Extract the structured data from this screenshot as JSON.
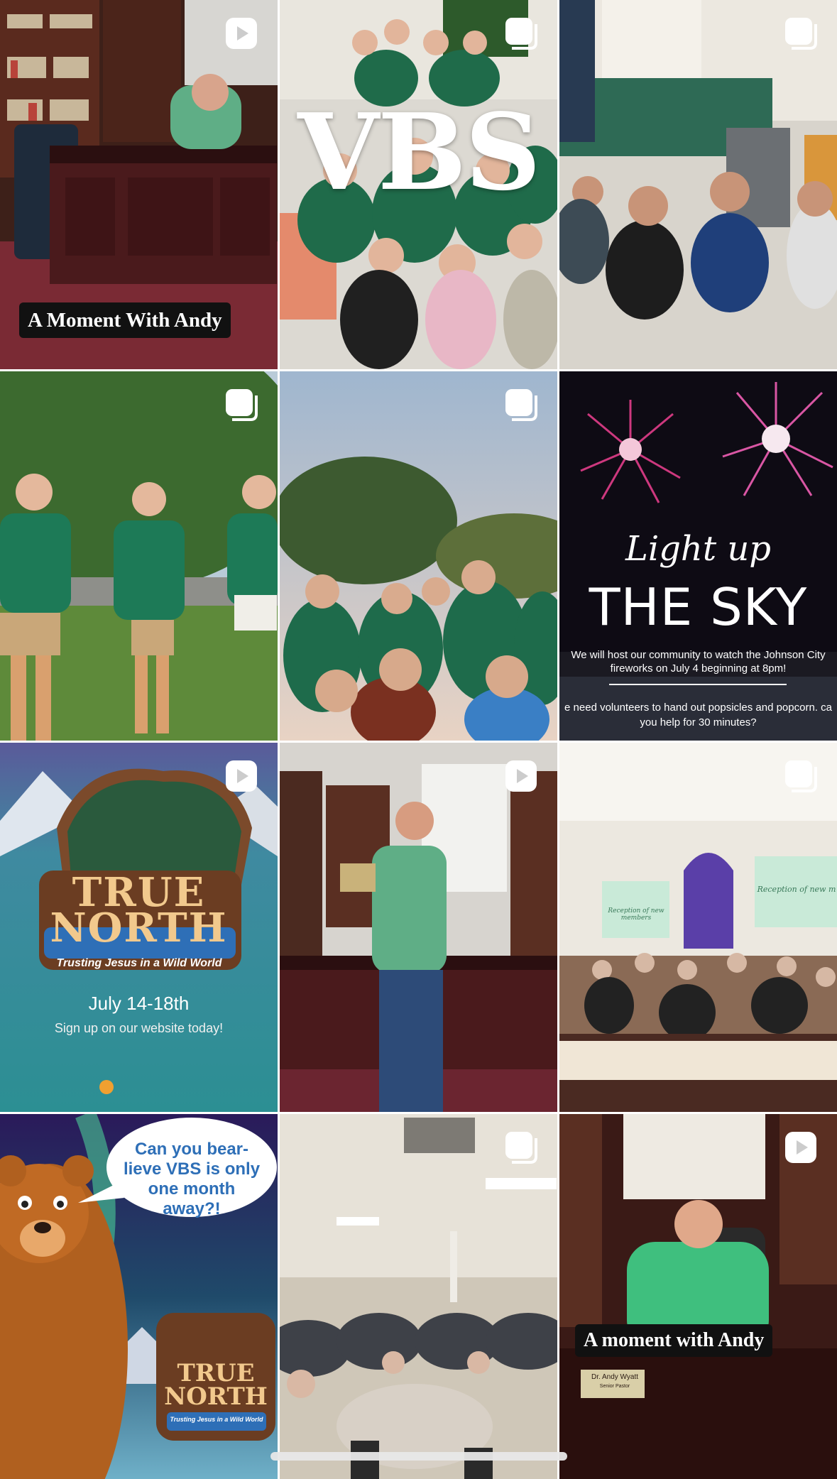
{
  "grid": {
    "tiles": [
      {
        "id": "t0",
        "type": "reel",
        "overlay": "A Moment With Andy"
      },
      {
        "id": "t1",
        "type": "carousel",
        "overlay": "VBS"
      },
      {
        "id": "t2",
        "type": "carousel"
      },
      {
        "id": "t3",
        "type": "carousel"
      },
      {
        "id": "t4",
        "type": "carousel"
      },
      {
        "id": "t5",
        "type": "image",
        "script": "Light up",
        "title": "THE SKY",
        "line1": "We will host our community to watch the Johnson City fireworks on July 4 beginning at 8pm!",
        "line2": "e need volunteers to hand out popsicles and popcorn. ca",
        "line3": "you help for 30 minutes?"
      },
      {
        "id": "t6",
        "type": "reel",
        "brand_top": "TRUE",
        "brand_bottom": "NORTH",
        "tagline": "Trusting Jesus in a Wild World",
        "dates": "July 14-18th",
        "cta": "Sign up on our website today!"
      },
      {
        "id": "t7",
        "type": "reel"
      },
      {
        "id": "t8",
        "type": "carousel",
        "banner_left": "Reception of new members",
        "banner_right": "Reception of new m"
      },
      {
        "id": "t9",
        "type": "image",
        "bubble": "Can you bear-lieve VBS is only one month away?!",
        "brand_top": "TRUE",
        "brand_bottom": "NORTH",
        "tagline": "Trusting Jesus in a Wild World"
      },
      {
        "id": "t10",
        "type": "carousel"
      },
      {
        "id": "t11",
        "type": "reel",
        "overlay": "A moment with Andy",
        "nameplate": "Dr. Andy Wyatt",
        "nameplate_sub": "Senior Pastor"
      }
    ]
  },
  "icons": {
    "reel": "play-icon",
    "carousel": "carousel-icon"
  },
  "colors": {
    "pill_bg": "#111111",
    "overlay_text": "#ffffff",
    "shirt_green": "#1f6b4a"
  }
}
